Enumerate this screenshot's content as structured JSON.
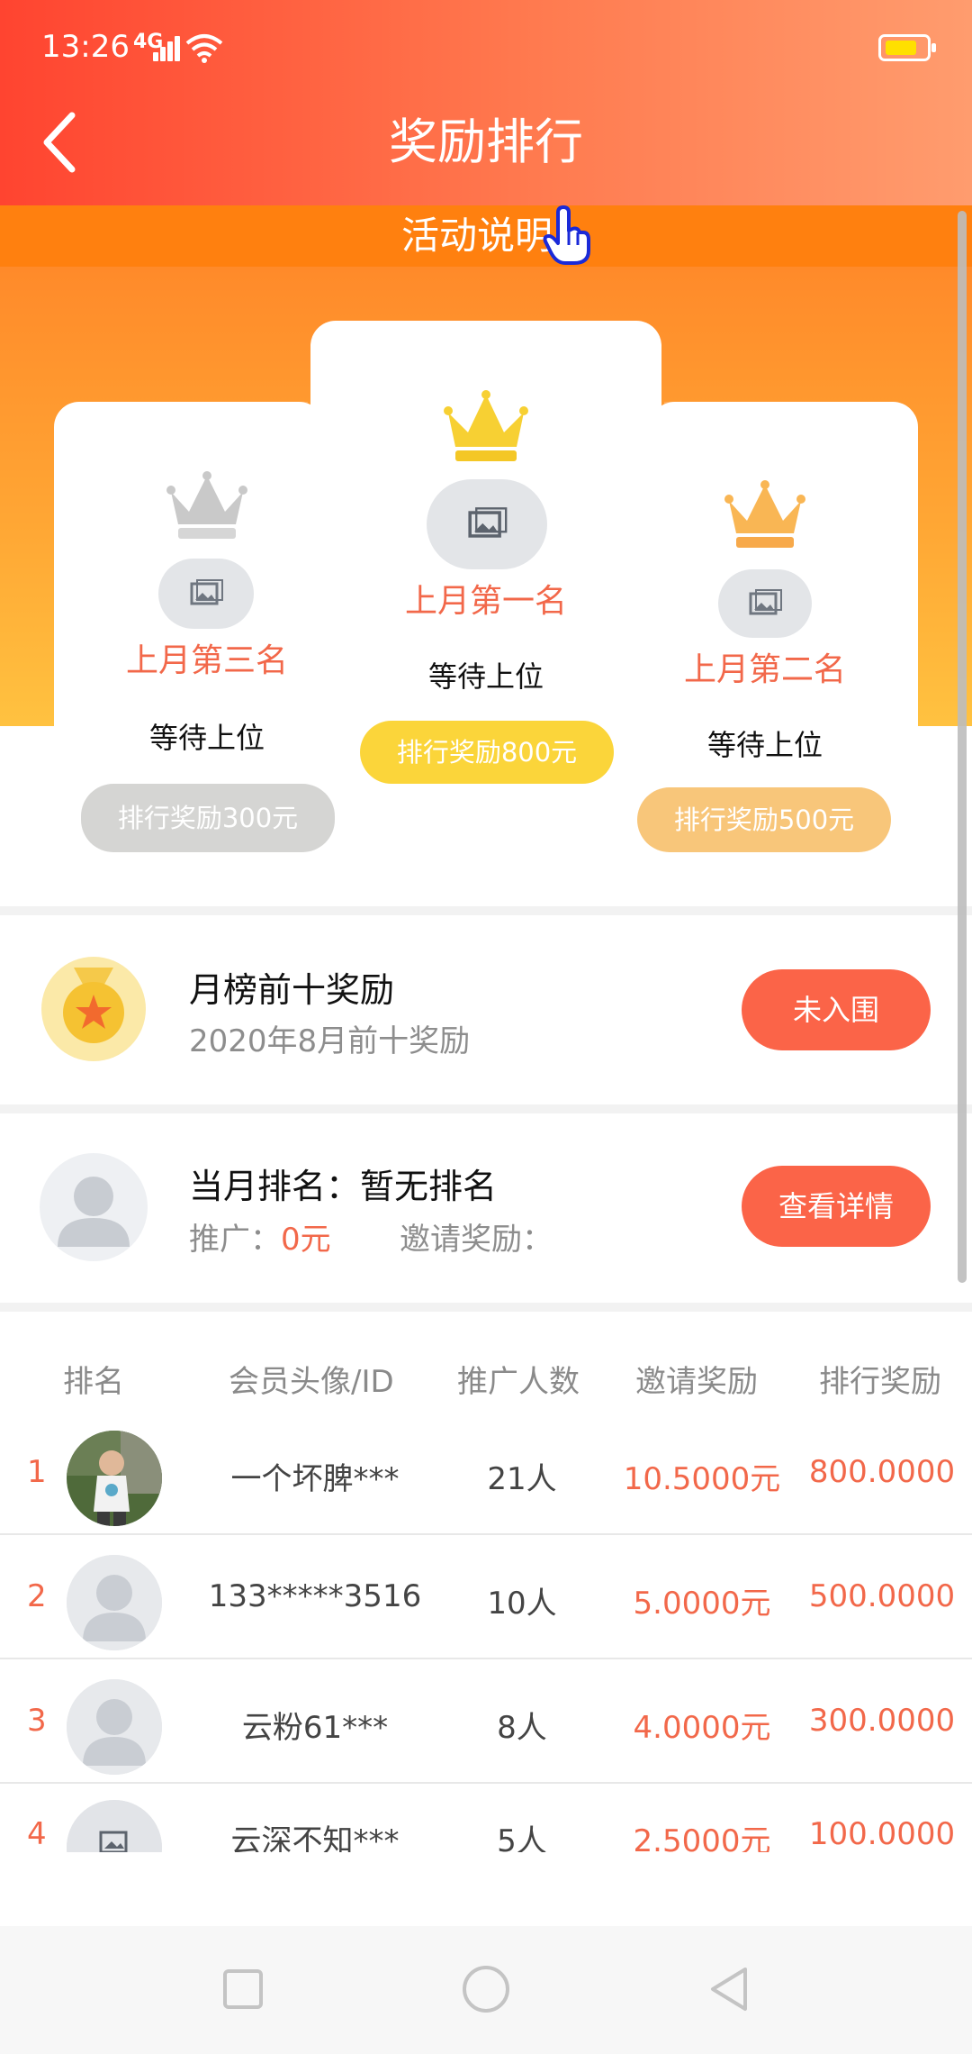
{
  "status_bar": {
    "time": "13:26",
    "network": "4G",
    "battery_color": "#ffe000"
  },
  "header": {
    "title": "奖励排行",
    "back_icon": "chevron-left-icon"
  },
  "notice": {
    "label": "活动说明",
    "icon": "hand-pointer-icon"
  },
  "podium": {
    "first": {
      "label": "上月第一名",
      "status": "等待上位",
      "prize": "排行奖励800元",
      "crown_color": "#f7d033",
      "prize_color": "#fbd53a"
    },
    "second": {
      "label": "上月第二名",
      "status": "等待上位",
      "prize": "排行奖励500元",
      "crown_color": "#f9b654",
      "prize_color": "#f8c67a"
    },
    "third": {
      "label": "上月第三名",
      "status": "等待上位",
      "prize": "排行奖励300元",
      "crown_color": "#c9c9c9",
      "prize_color": "#d5d5d3"
    }
  },
  "top_ten": {
    "title": "月榜前十奖励",
    "subtitle": "2020年8月前十奖励",
    "button": "未入围",
    "icon": "medal-icon"
  },
  "my_rank": {
    "title": "当月排名：暂无排名",
    "promo_label": "推广：",
    "promo_value": "0元",
    "invite_label": "邀请奖励：",
    "button": "查看详情"
  },
  "table": {
    "headers": [
      "排名",
      "会员头像/ID",
      "推广人数",
      "邀请奖励",
      "排行奖励"
    ],
    "rows": [
      {
        "rank": "1",
        "avatar": "photo",
        "id": "一个坏脾***",
        "count": "21人",
        "invite": "10.5000元",
        "reward": "800.0000"
      },
      {
        "rank": "2",
        "avatar": "default",
        "id": "133*****3516",
        "count": "10人",
        "invite": "5.0000元",
        "reward": "500.0000"
      },
      {
        "rank": "3",
        "avatar": "default",
        "id": "云粉61***",
        "count": "8人",
        "invite": "4.0000元",
        "reward": "300.0000"
      },
      {
        "rank": "4",
        "avatar": "image-placeholder",
        "id": "云深不知***",
        "count": "5人",
        "invite": "2.5000元",
        "reward": "100.0000"
      }
    ]
  },
  "nav": {
    "recent": "square-icon",
    "home": "circle-icon",
    "back": "triangle-back-icon"
  },
  "colors": {
    "accent": "#fb6448",
    "header_start": "#ff4430",
    "header_end": "#ff9c6e",
    "notice": "#ff800f"
  }
}
